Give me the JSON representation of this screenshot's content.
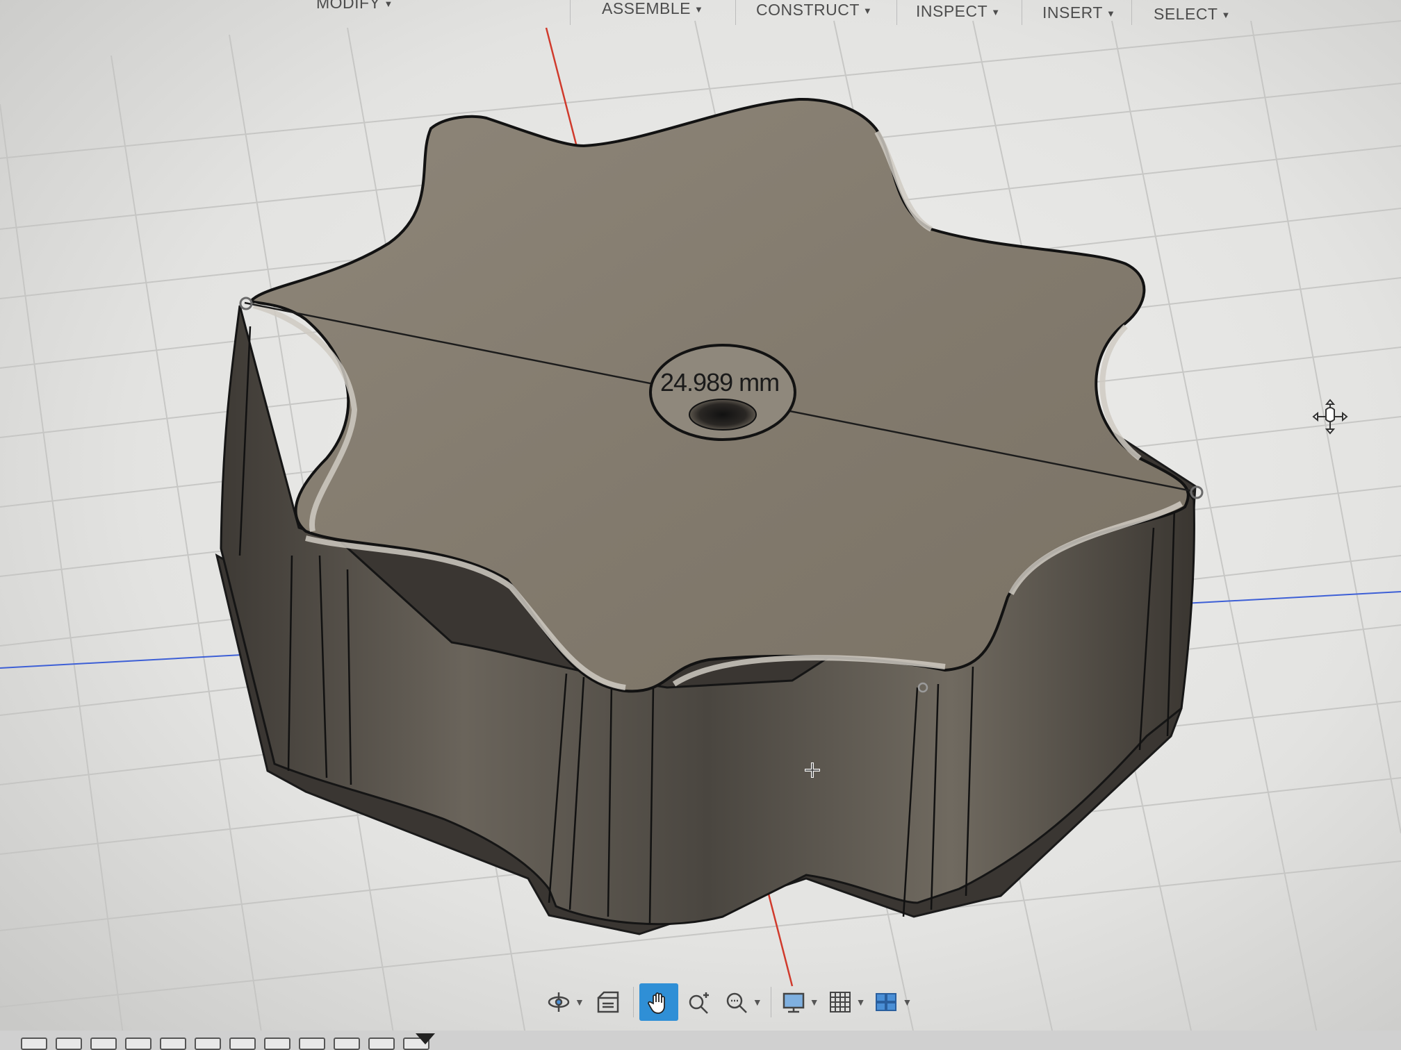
{
  "toolbar": {
    "menus": [
      {
        "label": "MODIFY"
      },
      {
        "label": "ASSEMBLE"
      },
      {
        "label": "CONSTRUCT"
      },
      {
        "label": "INSPECT"
      },
      {
        "label": "INSERT"
      },
      {
        "label": "SELECT"
      }
    ]
  },
  "viewport": {
    "dimension_label": "24.989 mm",
    "body_color": "#8a8174",
    "background_color": "#e6e6e4",
    "grid_color": "#c7c7c7",
    "x_axis_color": "#d03a2c",
    "y_axis_color": "#3d5fd6"
  },
  "nav_toolbar": {
    "tools": [
      {
        "icon": "orbit-icon",
        "has_dropdown": true
      },
      {
        "icon": "look-at-icon",
        "has_dropdown": false
      },
      {
        "icon": "pan-hand-icon",
        "active": true,
        "has_dropdown": false
      },
      {
        "icon": "zoom-icon",
        "has_dropdown": false
      },
      {
        "icon": "fit-window-icon",
        "has_dropdown": true
      },
      {
        "icon": "display-settings-icon",
        "has_dropdown": true
      },
      {
        "icon": "grid-icon",
        "has_dropdown": true
      },
      {
        "icon": "viewports-icon",
        "has_dropdown": true
      }
    ],
    "active_color": "#2f8fd6"
  },
  "timeline": {
    "items": 12
  }
}
